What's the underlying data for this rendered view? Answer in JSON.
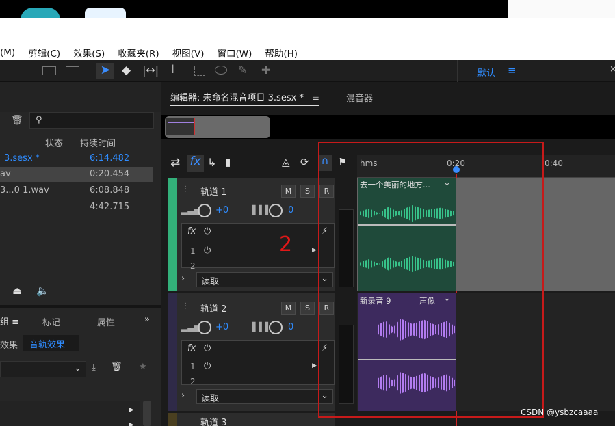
{
  "menu": [
    "(M)",
    "剪辑(C)",
    "效果(S)",
    "收藏夹(R)",
    "视图(V)",
    "窗口(W)",
    "帮助(H)"
  ],
  "toolbar": {
    "workspace": "默认"
  },
  "files": {
    "headers": {
      "status": "状态",
      "duration": "持续时间"
    },
    "rows": [
      {
        "name": "3.sesx *",
        "duration": "6:14.482"
      },
      {
        "name": "av",
        "duration": "0:20.454"
      },
      {
        "name": "3...0 1.wav",
        "duration": "6:08.848"
      },
      {
        "name": "",
        "duration": "4:42.715"
      }
    ]
  },
  "lower_panel": {
    "tabs": [
      "组",
      "标记",
      "属性"
    ],
    "subtabs": [
      "效果",
      "音轨效果"
    ]
  },
  "editor": {
    "tab_active": "编辑器: 未命名混音项目 3.sesx *",
    "tab_mixer": "混音器",
    "ruler": {
      "unit": "hms",
      "marks": [
        "0:20",
        "0:40"
      ]
    }
  },
  "tracks": [
    {
      "name": "轨道 1",
      "vol": "+0",
      "pan": "0",
      "mode": "读取",
      "fx_rows": [
        "1",
        "2"
      ],
      "clip": {
        "title": "去一个美丽的地方...",
        "color": "#1f4a3a",
        "wave": "#37c28a"
      },
      "color": "#33b07a"
    },
    {
      "name": "轨道 2",
      "vol": "+0",
      "pan": "0",
      "mode": "读取",
      "fx_rows": [
        "1",
        "2"
      ],
      "clip": {
        "title": "新录音 9",
        "extra": "声像",
        "color": "#3d2a5e",
        "wave": "#b27cf0"
      },
      "color": "#4a3a6a"
    },
    {
      "name": "轨道 3"
    }
  ],
  "annotation": {
    "number": "2",
    "watermark": "CSDN @ysbzcaaaa"
  },
  "buttons": {
    "m": "M",
    "s": "S",
    "r": "R",
    "i": "I",
    "fx": "fx"
  }
}
